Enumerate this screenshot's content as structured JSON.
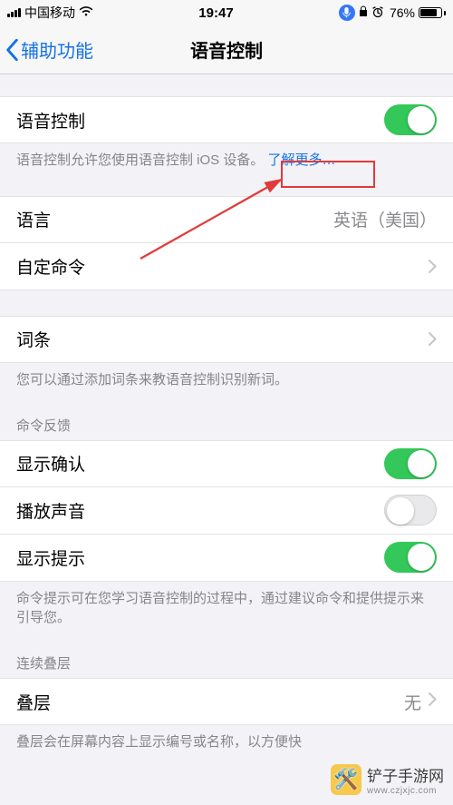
{
  "status": {
    "carrier": "中国移动",
    "time": "19:47",
    "battery_pct": "76%"
  },
  "nav": {
    "back_label": "辅助功能",
    "title": "语音控制"
  },
  "voice_control": {
    "row_label": "语音控制",
    "enabled": true,
    "footer_prefix": "语音控制允许您使用语音控制 iOS 设备。",
    "learn_more": "了解更多…"
  },
  "language_row": {
    "label": "语言",
    "value": "英语（美国）"
  },
  "custom_commands": {
    "label": "自定命令"
  },
  "vocab": {
    "label": "词条",
    "footer": "您可以通过添加词条来教语音控制识别新词。"
  },
  "feedback": {
    "header": "命令反馈",
    "show_confirm": {
      "label": "显示确认",
      "on": true
    },
    "play_sound": {
      "label": "播放声音",
      "on": false
    },
    "show_hints": {
      "label": "显示提示",
      "on": true
    },
    "footer": "命令提示可在您学习语音控制的过程中，通过建议命令和提供提示来引导您。"
  },
  "overlay": {
    "header": "连续叠层",
    "row_label": "叠层",
    "row_value": "无",
    "footer_partial": "叠层会在屏幕内容上显示编号或名称，以方便快"
  },
  "watermark": {
    "brand": "铲子手游网",
    "url": "www.czjxjc.com"
  }
}
